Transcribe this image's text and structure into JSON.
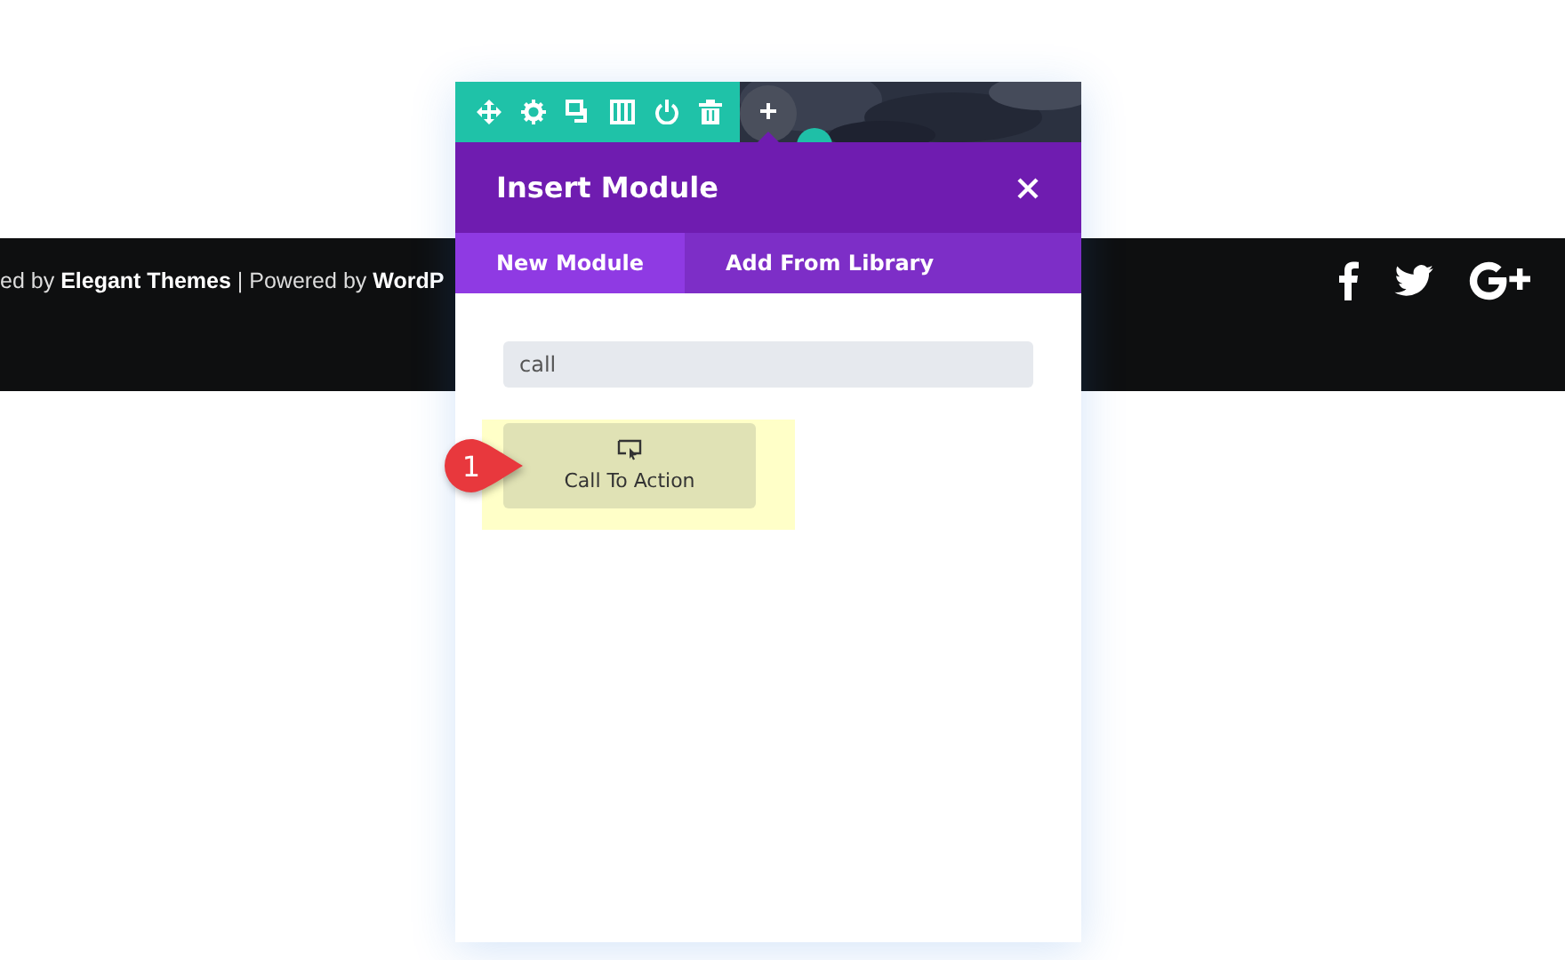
{
  "footer": {
    "credit": "ed by **Elegant Themes** | Powered by **WordP**"
  },
  "modal": {
    "title": "Insert Module",
    "tabs": [
      {
        "label": "New Module",
        "selected": true
      },
      {
        "label": "Add From Library",
        "selected": false
      }
    ],
    "search": {
      "value": "call"
    },
    "modules": [
      {
        "label": "Call To Action",
        "highlighted": true
      }
    ],
    "callout": "1"
  }
}
